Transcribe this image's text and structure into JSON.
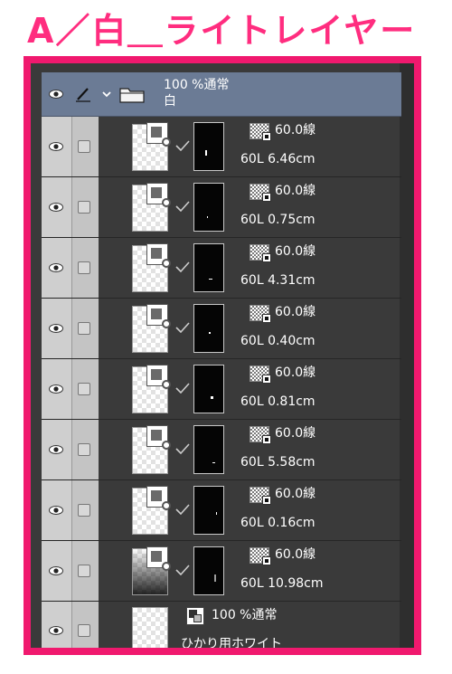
{
  "title": "A／白＿ライトレイヤー",
  "folder": {
    "opacity_mode": "100 %通常",
    "name": "白"
  },
  "layers": [
    {
      "tone": "60.0線",
      "info": "60L 6.46cm",
      "thumb": "light"
    },
    {
      "tone": "60.0線",
      "info": "60L 0.75cm",
      "thumb": "light"
    },
    {
      "tone": "60.0線",
      "info": "60L 4.31cm",
      "thumb": "light"
    },
    {
      "tone": "60.0線",
      "info": "60L 0.40cm",
      "thumb": "light"
    },
    {
      "tone": "60.0線",
      "info": "60L 0.81cm",
      "thumb": "light"
    },
    {
      "tone": "60.0線",
      "info": "60L 5.58cm",
      "thumb": "light"
    },
    {
      "tone": "60.0線",
      "info": "60L 0.16cm",
      "thumb": "light"
    },
    {
      "tone": "60.0線",
      "info": "60L 10.98cm",
      "thumb": "dark"
    }
  ],
  "last_layer": {
    "opacity_mode": "100 %通常",
    "name": "ひかり用ホワイト"
  },
  "colors": {
    "frame": "#f0196e",
    "title": "#ff2d7f",
    "panel": "#3a3a3a",
    "folder_row": "#6b7b95"
  },
  "icons": [
    "eye-icon",
    "pen-icon",
    "chevron-down-icon",
    "folder-icon",
    "checkbox-icon",
    "checkmark-icon",
    "tone-icon",
    "layer-thumbnail",
    "layer-mask"
  ]
}
